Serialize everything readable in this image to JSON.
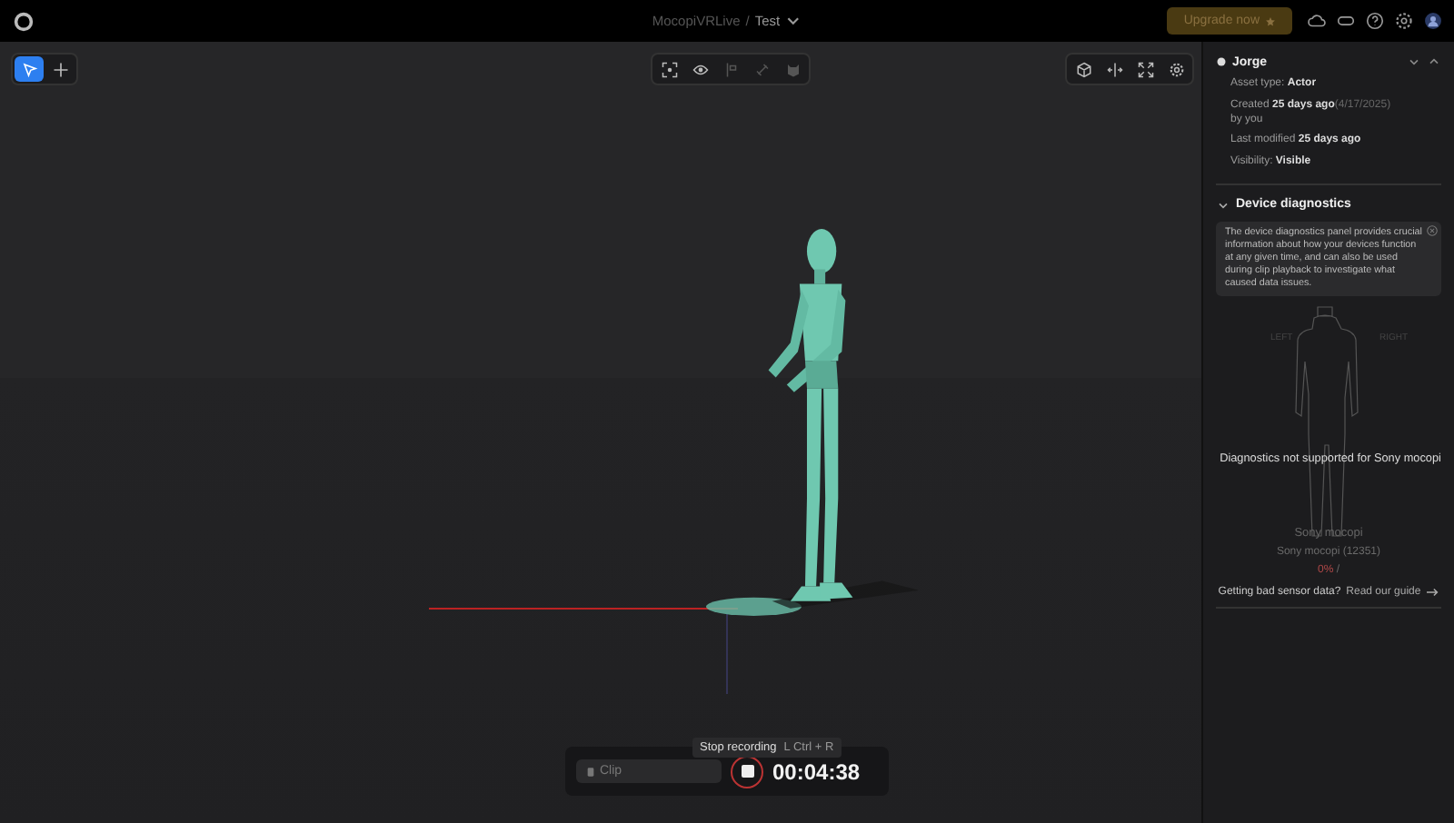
{
  "topbar": {
    "project": "MocopiVRLive",
    "separator": "/",
    "scene": "Test",
    "upgrade_button": "Upgrade now"
  },
  "left_tools": [
    {
      "kind": "select",
      "selected": true
    },
    {
      "kind": "move",
      "selected": false
    }
  ],
  "center_tools": [
    {
      "kind": "focus",
      "disabled": false
    },
    {
      "kind": "eye",
      "disabled": false
    },
    {
      "kind": "flag",
      "disabled": true
    },
    {
      "kind": "link",
      "disabled": true
    },
    {
      "kind": "cat",
      "disabled": true
    }
  ],
  "right_tools": [
    {
      "kind": "cube"
    },
    {
      "kind": "mirror"
    },
    {
      "kind": "expand"
    },
    {
      "kind": "gear"
    }
  ],
  "recording": {
    "clip_placeholder": "Clip",
    "tooltip": "Stop recording",
    "shortcut": "L Ctrl + R",
    "time": "00:04:38"
  },
  "asset": {
    "name": "Jorge",
    "expanded": true,
    "rows": [
      {
        "label": "Asset type:",
        "value": "Actor"
      },
      {
        "label": "Created",
        "value": "25 days ago",
        "extra": "(4/17/2025)",
        "line2": "by you"
      },
      {
        "label": "Last modified",
        "value": "25 days ago"
      },
      {
        "label": "Visibility:",
        "value": "Visible"
      }
    ]
  },
  "diagnostics": {
    "title": "Device diagnostics",
    "expanded": true,
    "info": "The device diagnostics panel provides crucial information about how your devices function at any given time, and can also be used during clip playback to investigate what caused data issues.",
    "left": "LEFT",
    "right": "RIGHT",
    "message": "Diagnostics not supported for Sony mocopi",
    "device": "Sony mocopi",
    "device_id": "Sony mocopi (12351)",
    "battery": "0%",
    "battery_sep": "/",
    "help_text": "Getting bad sensor data?",
    "help_link": "Read our guide"
  }
}
